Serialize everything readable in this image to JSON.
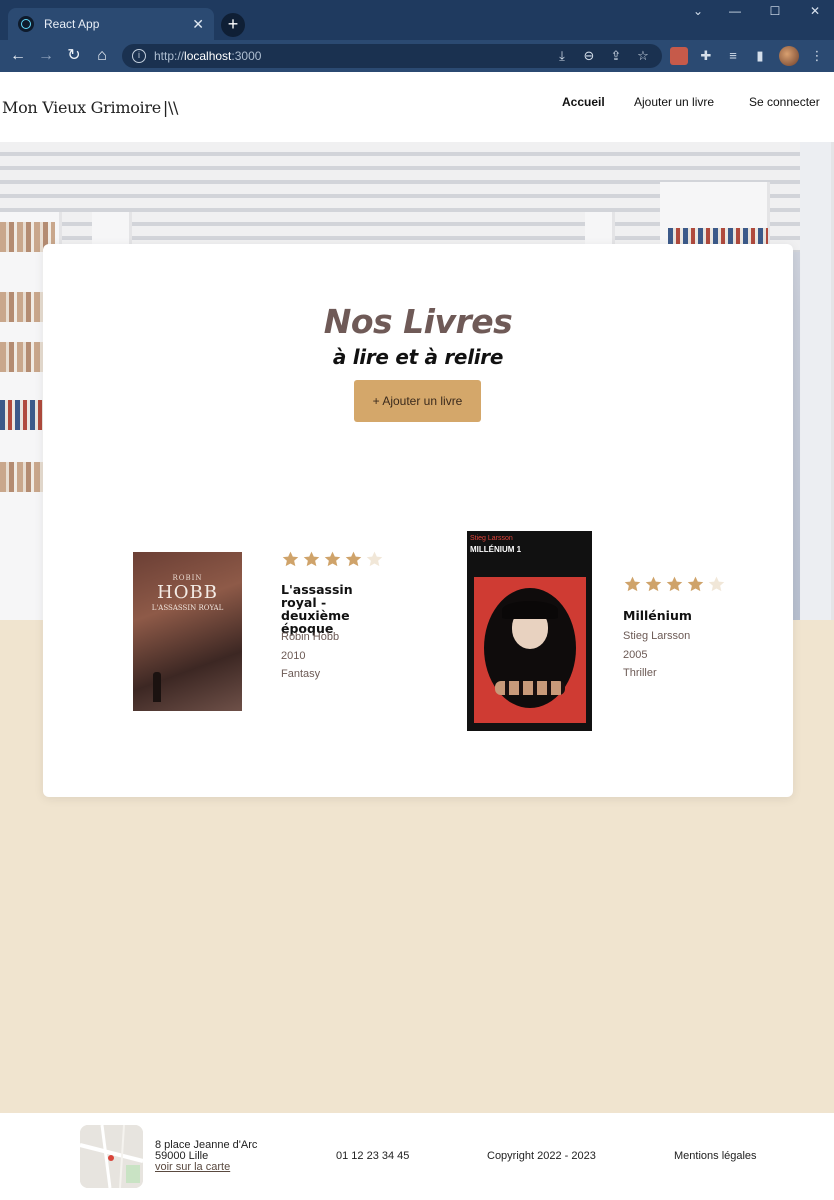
{
  "browser": {
    "tab_title": "React App",
    "tab_close": "✕",
    "new_tab": "+",
    "url_scheme": "http://",
    "url_host": "localhost",
    "url_port": ":3000",
    "window_controls": [
      "⌄",
      "—",
      "☐",
      "✕"
    ]
  },
  "site": {
    "logo": "Mon Vieux Grimoire",
    "logo_mark": "|\\\\",
    "nav": [
      {
        "label": "Accueil",
        "active": true
      },
      {
        "label": "Ajouter un livre",
        "active": false
      },
      {
        "label": "Se connecter",
        "active": false
      }
    ]
  },
  "main": {
    "title": "Nos Livres",
    "subtitle": "à lire et à relire",
    "add_button": "+ Ajouter un livre"
  },
  "books": [
    {
      "title": "L'assassin royal - deuxième époque",
      "author": "Robin Hobb",
      "year": "2010",
      "genre": "Fantasy",
      "rating": 4,
      "cover_author": "ROBIN",
      "cover_name": "HOBB",
      "cover_title": "L'ASSASSIN ROYAL"
    },
    {
      "title": "Millénium",
      "author": "Stieg Larsson",
      "year": "2005",
      "genre": "Thriller",
      "rating": 4,
      "cover_author": "Stieg Larsson",
      "cover_title": "MILLÉNIUM 1"
    }
  ],
  "footer": {
    "address_line1": "8 place Jeanne d'Arc",
    "address_line2": "59000 Lille",
    "map_link": "voir sur la carte",
    "phone": "01 12 23 34 45",
    "copyright": "Copyright 2022 - 2023",
    "legal": "Mentions légales"
  },
  "colors": {
    "accent": "#d4a76a",
    "star_filled": "#cfa36a",
    "star_empty": "#f1e7d8",
    "background": "#f0e4cf",
    "title": "#6f5a57"
  },
  "icons": [
    "back-icon",
    "forward-icon",
    "reload-icon",
    "home-icon",
    "info-icon",
    "download-icon",
    "zoom-icon",
    "share-icon",
    "bookmark-star-icon",
    "extensions-icon",
    "media-icon",
    "sidepanel-icon",
    "menu-icon"
  ]
}
